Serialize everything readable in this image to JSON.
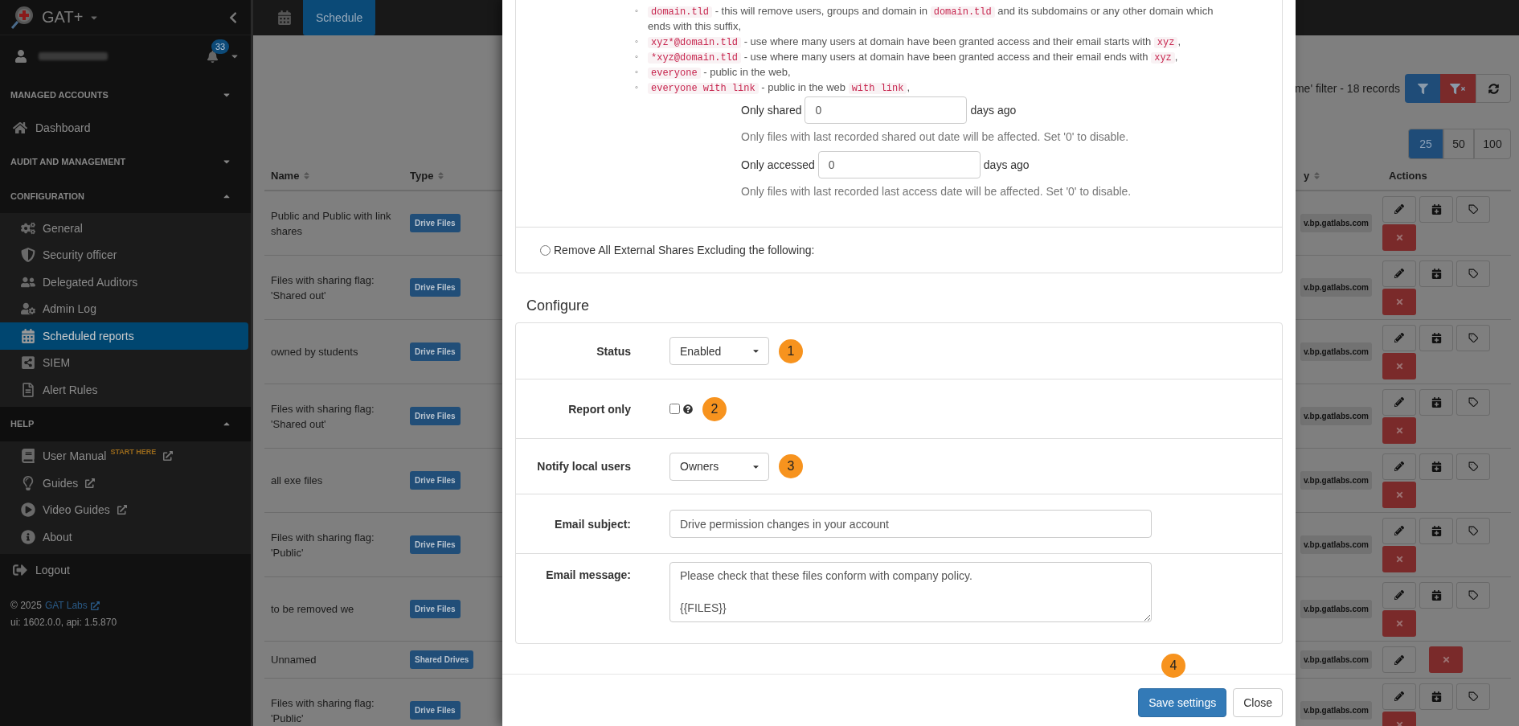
{
  "sidebar": {
    "app_name": "GAT+",
    "notification_count": "33",
    "entries": [
      {
        "kind": "section",
        "label": "MANAGED ACCOUNTS",
        "expanded": false
      },
      {
        "kind": "link",
        "label": "Dashboard"
      },
      {
        "kind": "section",
        "label": "AUDIT AND MANAGEMENT",
        "expanded": false
      },
      {
        "kind": "section",
        "label": "CONFIGURATION",
        "expanded": true,
        "items": [
          {
            "label": "General",
            "selected": false
          },
          {
            "label": "Security officer",
            "selected": false
          },
          {
            "label": "Delegated Auditors",
            "selected": false
          },
          {
            "label": "Admin Log",
            "selected": false
          },
          {
            "label": "Scheduled reports",
            "selected": true
          },
          {
            "label": "SIEM",
            "selected": false
          },
          {
            "label": "Alert Rules",
            "selected": false
          }
        ]
      },
      {
        "kind": "section",
        "label": "HELP",
        "expanded": true,
        "items": [
          {
            "label": "User Manual",
            "note": "START HERE",
            "external": true,
            "selected": false
          },
          {
            "label": "Guides",
            "external": true,
            "selected": false
          },
          {
            "label": "Video Guides",
            "external": true,
            "selected": false
          },
          {
            "label": "About",
            "external": false,
            "selected": false
          }
        ]
      },
      {
        "kind": "link",
        "label": "Logout"
      }
    ],
    "footer": {
      "copyright": "© 2025",
      "link": "GAT Labs",
      "version": "ui: 1602.0.0, api: 1.5.870"
    }
  },
  "topbar": {
    "tabs": [
      {
        "label": "Schedule",
        "selected": true
      }
    ]
  },
  "toolbar": {
    "filter_summary": "me' filter -  18 records",
    "page_sizes": [
      {
        "label": "25",
        "selected": true
      },
      {
        "label": "50",
        "selected": false
      },
      {
        "label": "100",
        "selected": false
      }
    ]
  },
  "table": {
    "columns": [
      {
        "label": "Name",
        "sortable": true
      },
      {
        "label": "Type",
        "sortable": true
      },
      {
        "label": "y",
        "sortable": true
      },
      {
        "label": "Actions",
        "sortable": false
      }
    ],
    "rows": [
      {
        "name": "Public and Public with link shares",
        "type": "Drive Files",
        "owner": "v.bp.gatlabs.com",
        "kind": "full"
      },
      {
        "name": "Files with sharing flag: 'Shared out'",
        "type": "Drive Files",
        "owner": "v.bp.gatlabs.com",
        "kind": "full"
      },
      {
        "name": "owned by students",
        "type": "Drive Files",
        "owner": "v.bp.gatlabs.com",
        "kind": "full"
      },
      {
        "name": "Files with sharing flag: 'Shared out'",
        "type": "Drive Files",
        "owner": "v.bp.gatlabs.com",
        "kind": "full"
      },
      {
        "name": "all exe files",
        "type": "Drive Files",
        "owner": "v.bp.gatlabs.com",
        "kind": "full"
      },
      {
        "name": "Files with sharing flag: 'Public'",
        "type": "Drive Files",
        "owner": "v.bp.gatlabs.com",
        "kind": "full"
      },
      {
        "name": "to be removed we",
        "type": "Drive Files",
        "owner": "v.bp.gatlabs.com",
        "kind": "full"
      },
      {
        "name": "Unnamed",
        "type": "Shared Drives",
        "owner": "v.bp.gatlabs.com",
        "kind": "compact"
      },
      {
        "name": "Files with sharing flag: 'Public'",
        "type": "Drive Files",
        "owner": "v.bp.gatlabs.com",
        "kind": "full"
      }
    ]
  },
  "modal": {
    "rules": [
      {
        "marker": "◦",
        "segments": [
          {
            "kind": "code",
            "text": "domain.tld"
          },
          {
            "kind": "text",
            "text": " - this will remove users, groups and domain in "
          },
          {
            "kind": "code",
            "text": "domain.tld"
          },
          {
            "kind": "text",
            "text": " and its subdomains or any other domain which ends with this suffix,"
          }
        ]
      },
      {
        "marker": "◦",
        "segments": [
          {
            "kind": "code",
            "text": "xyz*@domain.tld"
          },
          {
            "kind": "text",
            "text": " - use where many users at domain have been granted access and their email starts with "
          },
          {
            "kind": "code",
            "text": "xyz"
          },
          {
            "kind": "text",
            "text": ","
          }
        ]
      },
      {
        "marker": "◦",
        "segments": [
          {
            "kind": "code",
            "text": "*xyz@domain.tld"
          },
          {
            "kind": "text",
            "text": " - use where many users at domain have been granted access and their email ends with "
          },
          {
            "kind": "code",
            "text": "xyz"
          },
          {
            "kind": "text",
            "text": ","
          }
        ]
      },
      {
        "marker": "◦",
        "segments": [
          {
            "kind": "code",
            "text": "everyone"
          },
          {
            "kind": "text",
            "text": " - public in the web,"
          }
        ]
      },
      {
        "marker": "◦",
        "segments": [
          {
            "kind": "code",
            "text": "everyone with link"
          },
          {
            "kind": "text",
            "text": " - public in the web "
          },
          {
            "kind": "code",
            "text": "with link"
          },
          {
            "kind": "text",
            "text": ","
          }
        ]
      }
    ],
    "day_filters": [
      {
        "label": "Only shared",
        "value": "0",
        "unit": "days ago",
        "help": "Only files with last recorded shared out date will be affected. Set '0' to disable."
      },
      {
        "label": "Only accessed",
        "value": "0",
        "unit": "days ago",
        "help": "Only files with last recorded last access date will be affected. Set '0' to disable."
      }
    ],
    "exclusion_option": {
      "label": "Remove All External Shares Excluding the following:",
      "selected": false
    },
    "configure": {
      "title": "Configure",
      "rows": [
        {
          "kind": "select",
          "label": "Status",
          "value": "Enabled",
          "step": "1"
        },
        {
          "kind": "checkbox",
          "label": "Report only",
          "checked": false,
          "help": true,
          "step": "2"
        },
        {
          "kind": "select",
          "label": "Notify local users",
          "value": "Owners",
          "step": "3"
        },
        {
          "kind": "text",
          "label": "Email subject:",
          "value": "Drive permission changes in your account"
        },
        {
          "kind": "textarea",
          "label": "Email message:",
          "value": "Please check that these files conform with company policy.\n\n{{FILES}}"
        }
      ]
    },
    "footer": {
      "step": "4",
      "buttons": [
        {
          "label": "Save settings",
          "kind": "primary"
        },
        {
          "label": "Close",
          "kind": "default"
        }
      ]
    }
  }
}
